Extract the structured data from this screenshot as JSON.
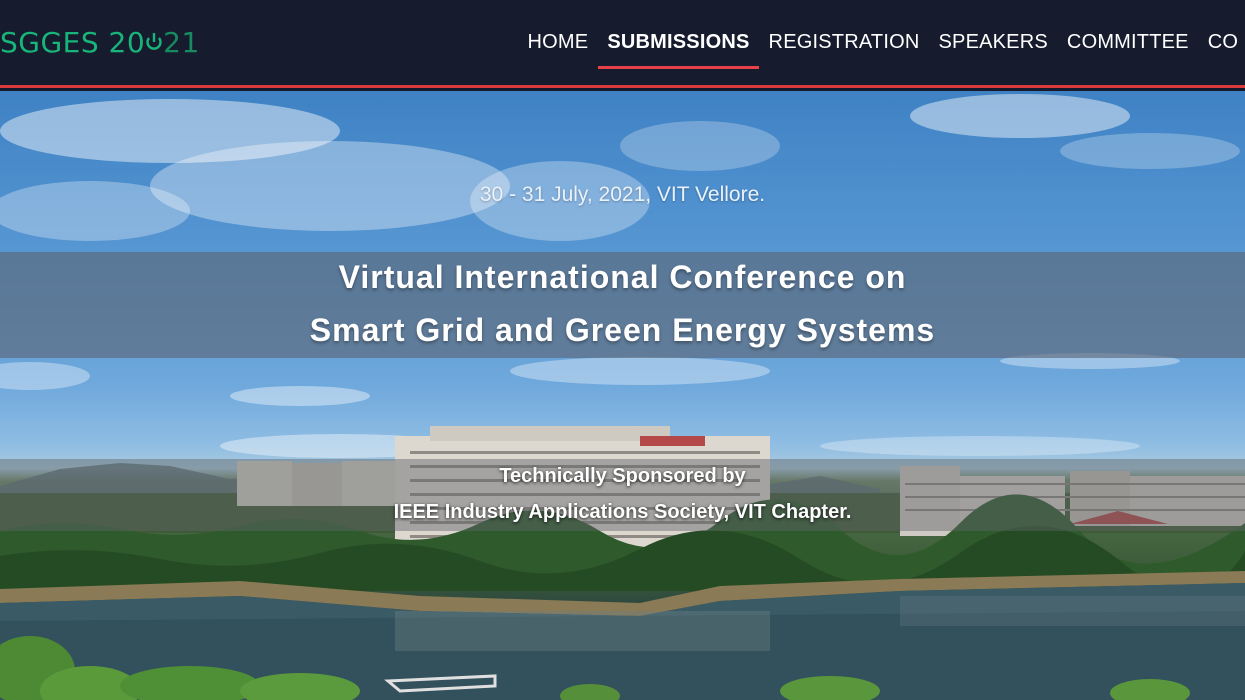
{
  "brand": {
    "prefix": "SGGES 20",
    "suffix": "21"
  },
  "nav": {
    "items": [
      {
        "label": "HOME",
        "active": false
      },
      {
        "label": "SUBMISSIONS",
        "active": true
      },
      {
        "label": "REGISTRATION",
        "active": false
      },
      {
        "label": "SPEAKERS",
        "active": false
      },
      {
        "label": "COMMITTEE",
        "active": false
      },
      {
        "label": "CO",
        "active": false
      }
    ]
  },
  "hero": {
    "date_location": "30 - 31 July, 2021, VIT Vellore.",
    "title_line1": "Virtual International Conference on",
    "title_line2": "Smart Grid and Green Energy Systems",
    "sponsor_line1": "Technically Sponsored by",
    "sponsor_line2": "IEEE Industry Applications Society, VIT Chapter."
  },
  "colors": {
    "navbar_bg": "#161c2e",
    "accent_red": "#e8414a",
    "brand_green": "#18b57a"
  }
}
